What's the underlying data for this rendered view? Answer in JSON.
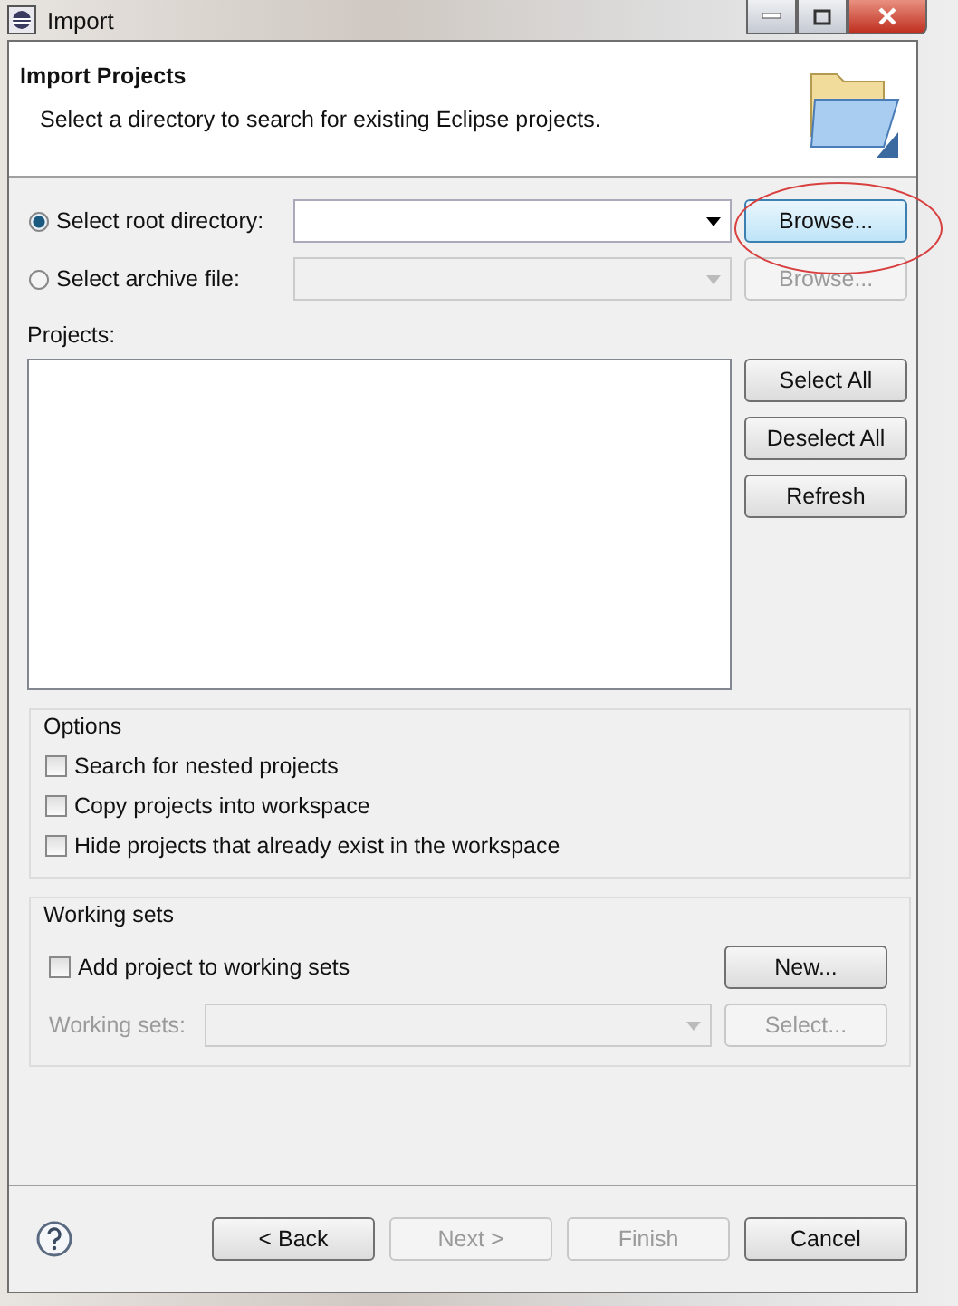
{
  "window": {
    "title": "Import"
  },
  "header": {
    "title": "Import Projects",
    "description": "Select a directory to search for existing Eclipse projects."
  },
  "sources": [
    {
      "label": "Select root directory:",
      "selected": true,
      "combo_disabled": false,
      "browse": {
        "label": "Browse...",
        "disabled": false
      }
    },
    {
      "label": "Select archive file:",
      "selected": false,
      "combo_disabled": true,
      "browse": {
        "label": "Browse...",
        "disabled": true
      }
    }
  ],
  "projects": {
    "label": "Projects:",
    "buttons": [
      {
        "label": "Select All"
      },
      {
        "label": "Deselect All"
      },
      {
        "label": "Refresh"
      }
    ]
  },
  "options": {
    "title": "Options",
    "items": [
      {
        "label": "Search for nested projects",
        "checked": false
      },
      {
        "label": "Copy projects into workspace",
        "checked": false
      },
      {
        "label": "Hide projects that already exist in the workspace",
        "checked": false
      }
    ]
  },
  "working_sets": {
    "title": "Working sets",
    "add": {
      "label": "Add project to working sets",
      "checked": false
    },
    "new_button": {
      "label": "New...",
      "disabled": false
    },
    "field": {
      "label": "Working sets:",
      "disabled": true
    },
    "select_button": {
      "label": "Select...",
      "disabled": true
    }
  },
  "footer": {
    "buttons": [
      {
        "label": "< Back",
        "disabled": false
      },
      {
        "label": "Next >",
        "disabled": true
      },
      {
        "label": "Finish",
        "disabled": true
      },
      {
        "label": "Cancel",
        "disabled": false
      }
    ]
  }
}
